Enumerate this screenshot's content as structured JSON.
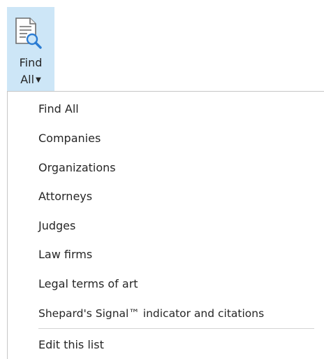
{
  "ribbon": {
    "button_label_line1": "Find",
    "button_label_line2": "All",
    "icon": "document-search-icon"
  },
  "menu": {
    "items": [
      {
        "label": "Find All"
      },
      {
        "label": "Companies"
      },
      {
        "label": "Organizations"
      },
      {
        "label": "Attorneys"
      },
      {
        "label": "Judges"
      },
      {
        "label": "Law firms"
      },
      {
        "label": "Legal terms of art"
      },
      {
        "label": "Shepard's Signal™ indicator and citations"
      }
    ],
    "footer_item": {
      "label": "Edit this list"
    }
  },
  "colors": {
    "ribbon_button_hover": "#cde6f7",
    "menu_border": "#c6c6c6",
    "icon_accent": "#2b7cd3"
  }
}
